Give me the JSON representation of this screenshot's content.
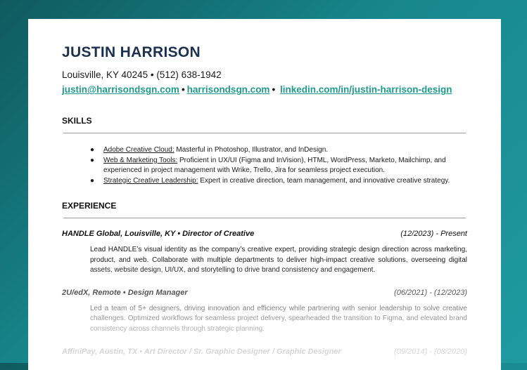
{
  "resume": {
    "name": "JUSTIN HARRISON",
    "contact_line": "Louisville, KY 40245 • (512) 638-1942",
    "email": "justin@harrisondsgn.com",
    "website": "harrisondsgn.com",
    "linkedin": "linkedin.com/in/justin-harrison-design",
    "separator": "•",
    "colors": {
      "name": "#1c3150",
      "link": "#1f9b8c",
      "background": "#17878c"
    }
  },
  "skills": {
    "title": "SKILLS",
    "items": [
      {
        "label": "Adobe Creative Cloud:",
        "text": " Masterful in Photoshop, Illustrator, and InDesign."
      },
      {
        "label": "Web & Marketing Tools:",
        "text": " Proficient in UX/UI (Figma and InVision), HTML, WordPress, Marketo, Mailchimp, and experienced in project management with Wrike, Trello, Jira for seamless project execution."
      },
      {
        "label": "Strategic Creative Leadership:",
        "text": " Expert in creative direction, team management, and innovative creative strategy."
      }
    ],
    "bullet": "●"
  },
  "experience": {
    "title": "EXPERIENCE",
    "jobs": [
      {
        "heading": "HANDLE Global, Louisville, KY • Director of Creative",
        "dates": "(12/2023) - Present",
        "description": "Lead HANDLE’s visual identity as the company’s creative expert, providing strategic design direction across marketing, product, and web. Collaborate with multiple departments to deliver high-impact creative solutions, overseeing digital assets, website design, UI/UX, and storytelling to drive brand consistency and engagement."
      },
      {
        "heading": "2U/edX, Remote • Design Manager",
        "dates": "(06/2021) - (12/2023)",
        "description": "Led a team of 5+ designers, driving innovation and efficiency while partnering with senior leadership to solve creative challenges. Optimized workflows for seamless project delivery, spearheaded the transition to Figma, and elevated brand consistency across channels through strategic planning."
      },
      {
        "heading": "AffiniPay, Austin, TX • Art Director / Sr. Graphic Designer / Graphic Designer",
        "dates": "(09/2014) - (08/2020)",
        "description": ""
      }
    ]
  }
}
